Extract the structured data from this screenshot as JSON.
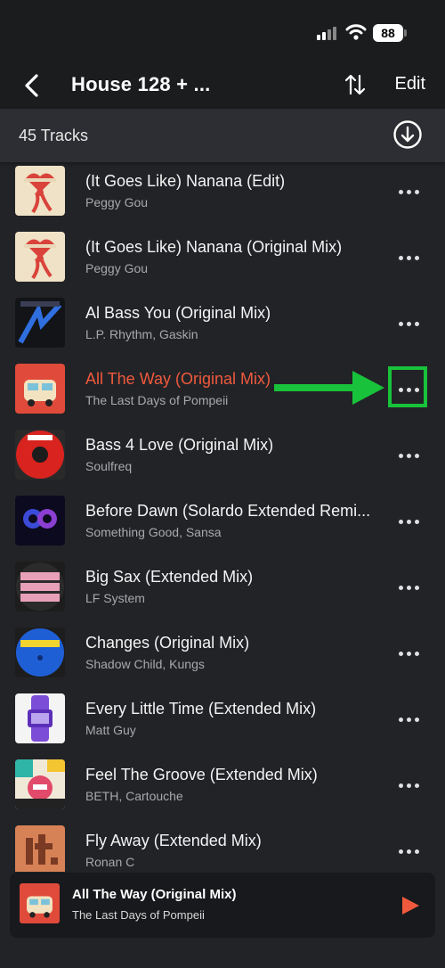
{
  "status": {
    "battery": "88"
  },
  "nav": {
    "title": "House 128 + ...",
    "edit_label": "Edit"
  },
  "playlist": {
    "track_count": "45 Tracks"
  },
  "tracks": [
    {
      "title": "(It Goes Like) Nanana (Edit)",
      "artist": "Peggy Gou"
    },
    {
      "title": "(It Goes Like) Nanana (Original Mix)",
      "artist": "Peggy Gou"
    },
    {
      "title": "Al Bass You (Original Mix)",
      "artist": "L.P. Rhythm, Gaskin"
    },
    {
      "title": "All The Way (Original Mix)",
      "artist": "The Last Days of Pompeii"
    },
    {
      "title": "Bass 4 Love (Original Mix)",
      "artist": "Soulfreq"
    },
    {
      "title": "Before Dawn (Solardo Extended Remi...",
      "artist": "Something Good, Sansa"
    },
    {
      "title": "Big Sax (Extended Mix)",
      "artist": "LF System"
    },
    {
      "title": "Changes (Original Mix)",
      "artist": "Shadow Child, Kungs"
    },
    {
      "title": "Every Little Time (Extended Mix)",
      "artist": "Matt Guy"
    },
    {
      "title": "Feel The Groove (Extended Mix)",
      "artist": "BETH, Cartouche"
    },
    {
      "title": "Fly Away (Extended Mix)",
      "artist": "Ronan C"
    }
  ],
  "now_playing": {
    "title": "All The Way (Original Mix)",
    "artist": "The Last Days of Pompeii"
  },
  "colors": {
    "accent": "#f05a3c",
    "annotation": "#18c23a",
    "background": "#222327"
  },
  "icons": [
    "back-chevron-icon",
    "sort-icon",
    "download-icon",
    "more-icon",
    "play-icon"
  ]
}
